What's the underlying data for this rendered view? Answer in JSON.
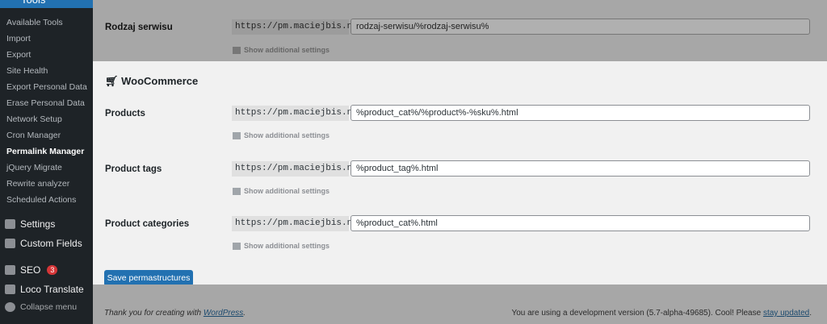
{
  "sidebar": {
    "tools": "Tools",
    "submenu": [
      "Available Tools",
      "Import",
      "Export",
      "Site Health",
      "Export Personal Data",
      "Erase Personal Data",
      "Network Setup",
      "Cron Manager",
      "Permalink Manager",
      "jQuery Migrate",
      "Rewrite analyzer",
      "Scheduled Actions"
    ],
    "settings": "Settings",
    "custom_fields": "Custom Fields",
    "seo": "SEO",
    "seo_badge": "3",
    "loco": "Loco Translate",
    "collapse": "Collapse menu"
  },
  "main": {
    "prefix": "https://pm.maciejbis.net/",
    "show_more": "Show additional settings",
    "rodzaj": {
      "label": "Rodzaj serwisu",
      "value": "rodzaj-serwisu/%rodzaj-serwisu%"
    },
    "woo_heading": "WooCommerce",
    "products": {
      "label": "Products",
      "value": "%product_cat%/%product%-%sku%.html"
    },
    "tags": {
      "label": "Product tags",
      "value": "%product_tag%.html"
    },
    "cats": {
      "label": "Product categories",
      "value": "%product_cat%.html"
    },
    "save": "Save permastructures"
  },
  "footer": {
    "thanks": "Thank you for creating with ",
    "wp": "WordPress",
    "dot": ".",
    "version": "You are using a development version (5.7-alpha-49685). Cool! Please ",
    "stay": "stay updated"
  }
}
